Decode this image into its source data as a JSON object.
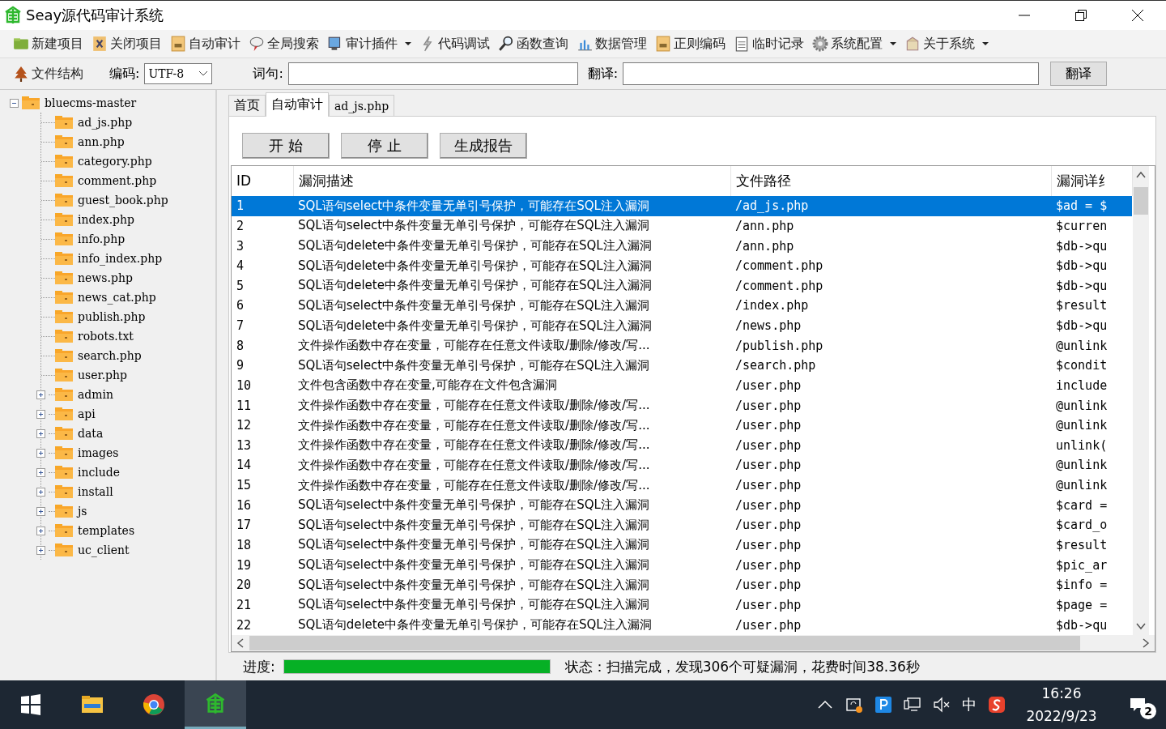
{
  "window": {
    "title": "Seay源代码审计系统"
  },
  "toolbar": [
    {
      "label": "新建项目",
      "dropdown": false
    },
    {
      "label": "关闭项目",
      "dropdown": false
    },
    {
      "label": "自动审计",
      "dropdown": false
    },
    {
      "label": "全局搜索",
      "dropdown": false
    },
    {
      "label": "审计插件",
      "dropdown": true
    },
    {
      "label": "代码调试",
      "dropdown": false
    },
    {
      "label": "函数查询",
      "dropdown": false
    },
    {
      "label": "数据管理",
      "dropdown": false
    },
    {
      "label": "正则编码",
      "dropdown": false
    },
    {
      "label": "临时记录",
      "dropdown": false
    },
    {
      "label": "系统配置",
      "dropdown": true
    },
    {
      "label": "关于系统",
      "dropdown": true
    }
  ],
  "toolbar2": {
    "structure_button": "文件结构",
    "encoding_label": "编码:",
    "encoding_value": "UTF-8",
    "query_label": "词句:",
    "translate_label": "翻译:",
    "translate_button": "翻译"
  },
  "tree": {
    "label": "bluecms-master",
    "expanded": true,
    "children": [
      {
        "label": "ad_js.php",
        "kind": "file"
      },
      {
        "label": "ann.php",
        "kind": "file"
      },
      {
        "label": "category.php",
        "kind": "file"
      },
      {
        "label": "comment.php",
        "kind": "file"
      },
      {
        "label": "guest_book.php",
        "kind": "file"
      },
      {
        "label": "index.php",
        "kind": "file"
      },
      {
        "label": "info.php",
        "kind": "file"
      },
      {
        "label": "info_index.php",
        "kind": "file"
      },
      {
        "label": "news.php",
        "kind": "file"
      },
      {
        "label": "news_cat.php",
        "kind": "file"
      },
      {
        "label": "publish.php",
        "kind": "file"
      },
      {
        "label": "robots.txt",
        "kind": "file"
      },
      {
        "label": "search.php",
        "kind": "file"
      },
      {
        "label": "user.php",
        "kind": "file"
      },
      {
        "label": "admin",
        "kind": "folder",
        "expanded": false
      },
      {
        "label": "api",
        "kind": "folder",
        "expanded": false
      },
      {
        "label": "data",
        "kind": "folder",
        "expanded": false
      },
      {
        "label": "images",
        "kind": "folder",
        "expanded": false
      },
      {
        "label": "include",
        "kind": "folder",
        "expanded": false
      },
      {
        "label": "install",
        "kind": "folder",
        "expanded": false
      },
      {
        "label": "js",
        "kind": "folder",
        "expanded": false
      },
      {
        "label": "templates",
        "kind": "folder",
        "expanded": false
      },
      {
        "label": "uc_client",
        "kind": "folder",
        "expanded": false
      }
    ]
  },
  "tabs": [
    {
      "label": "首页",
      "selected": false
    },
    {
      "label": "自动审计",
      "selected": true
    },
    {
      "label": "ad_js.php",
      "selected": false
    }
  ],
  "actions": [
    "开 始",
    "停 止",
    "生成报告"
  ],
  "table": {
    "columns": [
      "ID",
      "漏洞描述",
      "文件路径",
      "漏洞详纟"
    ],
    "rows": [
      {
        "id": "1",
        "desc": "SQL语句select中条件变量无单引号保护，可能存在SQL注入漏洞",
        "path": "/ad_js.php",
        "detail": "$ad = $",
        "selected": true
      },
      {
        "id": "2",
        "desc": "SQL语句select中条件变量无单引号保护，可能存在SQL注入漏洞",
        "path": "/ann.php",
        "detail": "$curren",
        "selected": false
      },
      {
        "id": "3",
        "desc": "SQL语句delete中条件变量无单引号保护，可能存在SQL注入漏洞",
        "path": "/ann.php",
        "detail": "$db->qu",
        "selected": false
      },
      {
        "id": "4",
        "desc": "SQL语句delete中条件变量无单引号保护，可能存在SQL注入漏洞",
        "path": "/comment.php",
        "detail": "$db->qu",
        "selected": false
      },
      {
        "id": "5",
        "desc": "SQL语句delete中条件变量无单引号保护，可能存在SQL注入漏洞",
        "path": "/comment.php",
        "detail": "$db->qu",
        "selected": false
      },
      {
        "id": "6",
        "desc": "SQL语句select中条件变量无单引号保护，可能存在SQL注入漏洞",
        "path": "/index.php",
        "detail": "$result",
        "selected": false
      },
      {
        "id": "7",
        "desc": "SQL语句delete中条件变量无单引号保护，可能存在SQL注入漏洞",
        "path": "/news.php",
        "detail": "$db->qu",
        "selected": false
      },
      {
        "id": "8",
        "desc": "文件操作函数中存在变量，可能存在任意文件读取/删除/修改/写...",
        "path": "/publish.php",
        "detail": "@unlink",
        "selected": false
      },
      {
        "id": "9",
        "desc": "SQL语句select中条件变量无单引号保护，可能存在SQL注入漏洞",
        "path": "/search.php",
        "detail": "$condit",
        "selected": false
      },
      {
        "id": "10",
        "desc": "文件包含函数中存在变量,可能存在文件包含漏洞",
        "path": "/user.php",
        "detail": "include",
        "selected": false
      },
      {
        "id": "11",
        "desc": "文件操作函数中存在变量，可能存在任意文件读取/删除/修改/写...",
        "path": "/user.php",
        "detail": "@unlink",
        "selected": false
      },
      {
        "id": "12",
        "desc": "文件操作函数中存在变量，可能存在任意文件读取/删除/修改/写...",
        "path": "/user.php",
        "detail": "@unlink",
        "selected": false
      },
      {
        "id": "13",
        "desc": "文件操作函数中存在变量，可能存在任意文件读取/删除/修改/写...",
        "path": "/user.php",
        "detail": "unlink(",
        "selected": false
      },
      {
        "id": "14",
        "desc": "文件操作函数中存在变量，可能存在任意文件读取/删除/修改/写...",
        "path": "/user.php",
        "detail": "@unlink",
        "selected": false
      },
      {
        "id": "15",
        "desc": "文件操作函数中存在变量，可能存在任意文件读取/删除/修改/写...",
        "path": "/user.php",
        "detail": "@unlink",
        "selected": false
      },
      {
        "id": "16",
        "desc": "SQL语句select中条件变量无单引号保护，可能存在SQL注入漏洞",
        "path": "/user.php",
        "detail": "$card =",
        "selected": false
      },
      {
        "id": "17",
        "desc": "SQL语句select中条件变量无单引号保护，可能存在SQL注入漏洞",
        "path": "/user.php",
        "detail": "$card_o",
        "selected": false
      },
      {
        "id": "18",
        "desc": "SQL语句select中条件变量无单引号保护，可能存在SQL注入漏洞",
        "path": "/user.php",
        "detail": "$result",
        "selected": false
      },
      {
        "id": "19",
        "desc": "SQL语句select中条件变量无单引号保护，可能存在SQL注入漏洞",
        "path": "/user.php",
        "detail": "$pic_ar",
        "selected": false
      },
      {
        "id": "20",
        "desc": "SQL语句select中条件变量无单引号保护，可能存在SQL注入漏洞",
        "path": "/user.php",
        "detail": "$info =",
        "selected": false
      },
      {
        "id": "21",
        "desc": "SQL语句select中条件变量无单引号保护，可能存在SQL注入漏洞",
        "path": "/user.php",
        "detail": "$page =",
        "selected": false
      },
      {
        "id": "22",
        "desc": "SQL语句delete中条件变量无单引号保护，可能存在SQL注入漏洞",
        "path": "/user.php",
        "detail": "$db->qu",
        "selected": false
      }
    ]
  },
  "status_bar": {
    "progress_label": "进度:",
    "level": 1,
    "status": "状态：扫描完成，发现306个可疑漏洞，花费时间38.36秒"
  },
  "taskbar": {
    "ime": "中",
    "time": "16:26",
    "date": "2022/9/23",
    "notifications": "2"
  }
}
